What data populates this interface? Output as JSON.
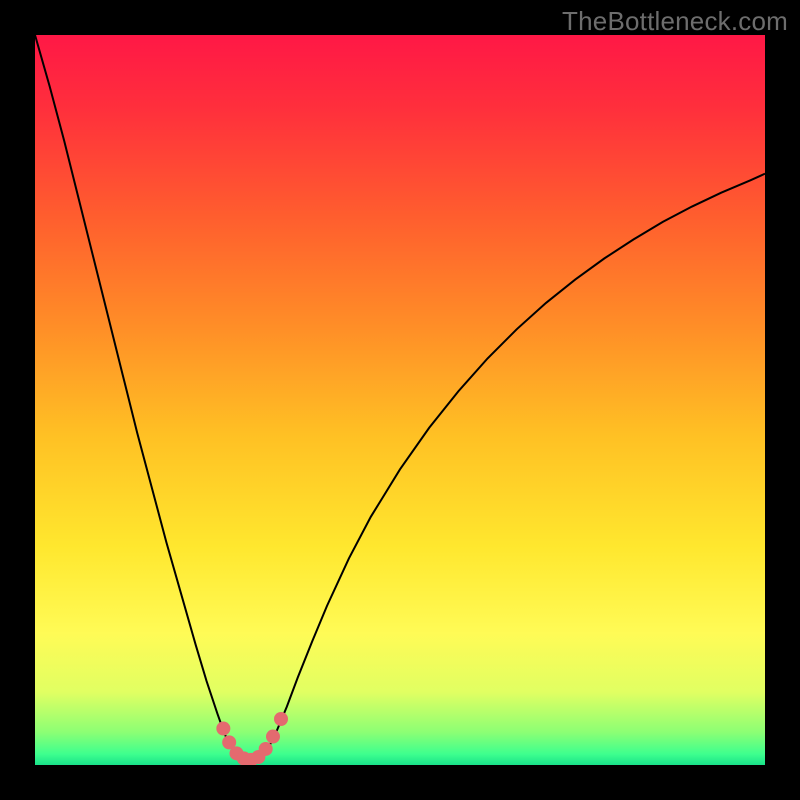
{
  "watermark": "TheBottleneck.com",
  "chart_data": {
    "type": "line",
    "title": "",
    "xlabel": "",
    "ylabel": "",
    "xlim": [
      0,
      100
    ],
    "ylim": [
      0,
      100
    ],
    "background_gradient": {
      "stops": [
        {
          "t": 0.0,
          "color": "#ff1846"
        },
        {
          "t": 0.1,
          "color": "#ff2f3c"
        },
        {
          "t": 0.25,
          "color": "#ff5e2e"
        },
        {
          "t": 0.4,
          "color": "#ff8e27"
        },
        {
          "t": 0.55,
          "color": "#ffc124"
        },
        {
          "t": 0.7,
          "color": "#ffe72e"
        },
        {
          "t": 0.82,
          "color": "#fffb56"
        },
        {
          "t": 0.9,
          "color": "#e1ff62"
        },
        {
          "t": 0.955,
          "color": "#8cff74"
        },
        {
          "t": 0.985,
          "color": "#3eff8e"
        },
        {
          "t": 1.0,
          "color": "#19e28a"
        }
      ]
    },
    "curve": {
      "color": "#000000",
      "width": 2,
      "comment": "Absolute-difference style curve |f(x)-target| shaped; y is % mismatch (100=top,0=bottom). x is normalized 0..100 across width.",
      "points": [
        {
          "x": 0.0,
          "y": 100.0
        },
        {
          "x": 2.0,
          "y": 93.0
        },
        {
          "x": 4.0,
          "y": 85.5
        },
        {
          "x": 6.0,
          "y": 77.5
        },
        {
          "x": 8.0,
          "y": 69.5
        },
        {
          "x": 10.0,
          "y": 61.5
        },
        {
          "x": 12.0,
          "y": 53.5
        },
        {
          "x": 14.0,
          "y": 45.5
        },
        {
          "x": 16.0,
          "y": 38.0
        },
        {
          "x": 18.0,
          "y": 30.5
        },
        {
          "x": 20.0,
          "y": 23.5
        },
        {
          "x": 22.0,
          "y": 16.5
        },
        {
          "x": 23.5,
          "y": 11.5
        },
        {
          "x": 25.0,
          "y": 7.0
        },
        {
          "x": 26.0,
          "y": 4.2
        },
        {
          "x": 27.0,
          "y": 2.2
        },
        {
          "x": 28.0,
          "y": 1.0
        },
        {
          "x": 29.0,
          "y": 0.4
        },
        {
          "x": 30.0,
          "y": 0.4
        },
        {
          "x": 31.0,
          "y": 1.0
        },
        {
          "x": 32.0,
          "y": 2.4
        },
        {
          "x": 33.0,
          "y": 4.4
        },
        {
          "x": 34.5,
          "y": 8.0
        },
        {
          "x": 36.0,
          "y": 12.0
        },
        {
          "x": 38.0,
          "y": 17.0
        },
        {
          "x": 40.0,
          "y": 21.8
        },
        {
          "x": 43.0,
          "y": 28.3
        },
        {
          "x": 46.0,
          "y": 34.0
        },
        {
          "x": 50.0,
          "y": 40.5
        },
        {
          "x": 54.0,
          "y": 46.2
        },
        {
          "x": 58.0,
          "y": 51.2
        },
        {
          "x": 62.0,
          "y": 55.7
        },
        {
          "x": 66.0,
          "y": 59.7
        },
        {
          "x": 70.0,
          "y": 63.3
        },
        {
          "x": 74.0,
          "y": 66.5
        },
        {
          "x": 78.0,
          "y": 69.4
        },
        {
          "x": 82.0,
          "y": 72.0
        },
        {
          "x": 86.0,
          "y": 74.4
        },
        {
          "x": 90.0,
          "y": 76.5
        },
        {
          "x": 94.0,
          "y": 78.4
        },
        {
          "x": 98.0,
          "y": 80.1
        },
        {
          "x": 100.0,
          "y": 81.0
        }
      ]
    },
    "markers": {
      "color": "#e46a6f",
      "radius": 7,
      "comment": "Cluster of salmon dots near the curve minimum, slight overlap.",
      "points": [
        {
          "x": 25.8,
          "y": 5.0
        },
        {
          "x": 26.6,
          "y": 3.1
        },
        {
          "x": 27.6,
          "y": 1.6
        },
        {
          "x": 28.6,
          "y": 0.9
        },
        {
          "x": 29.6,
          "y": 0.7
        },
        {
          "x": 30.6,
          "y": 1.1
        },
        {
          "x": 31.6,
          "y": 2.2
        },
        {
          "x": 32.6,
          "y": 3.9
        },
        {
          "x": 33.7,
          "y": 6.3
        }
      ]
    }
  }
}
